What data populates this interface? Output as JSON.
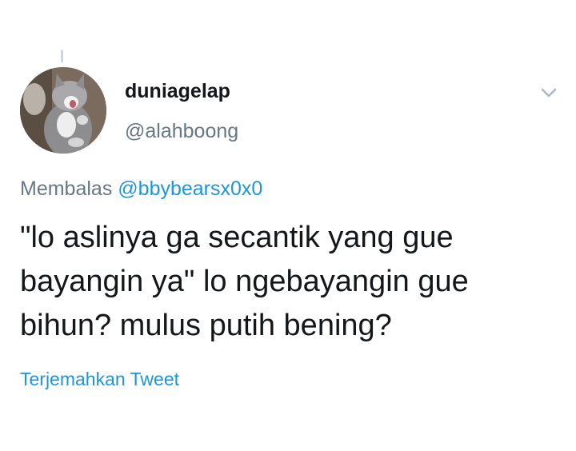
{
  "tweet": {
    "avatar_icon": "cat-avatar-image",
    "display_name": "duniagelap",
    "handle": "@alahboong",
    "caret_icon": "chevron-down-icon",
    "reply_prefix": "Membalas",
    "reply_mention": "@bbybearsx0x0",
    "text_lines": [
      "\"lo aslinya ga secantik yang gue",
      "bayangin ya\" lo ngebayangin gue",
      "bihun? mulus putih bening?"
    ],
    "translate_label": "Terjemahkan Tweet"
  },
  "colors": {
    "text": "#14171a",
    "secondary": "#657786",
    "link": "#1b95e0",
    "thread_line": "#ccd6dd"
  }
}
